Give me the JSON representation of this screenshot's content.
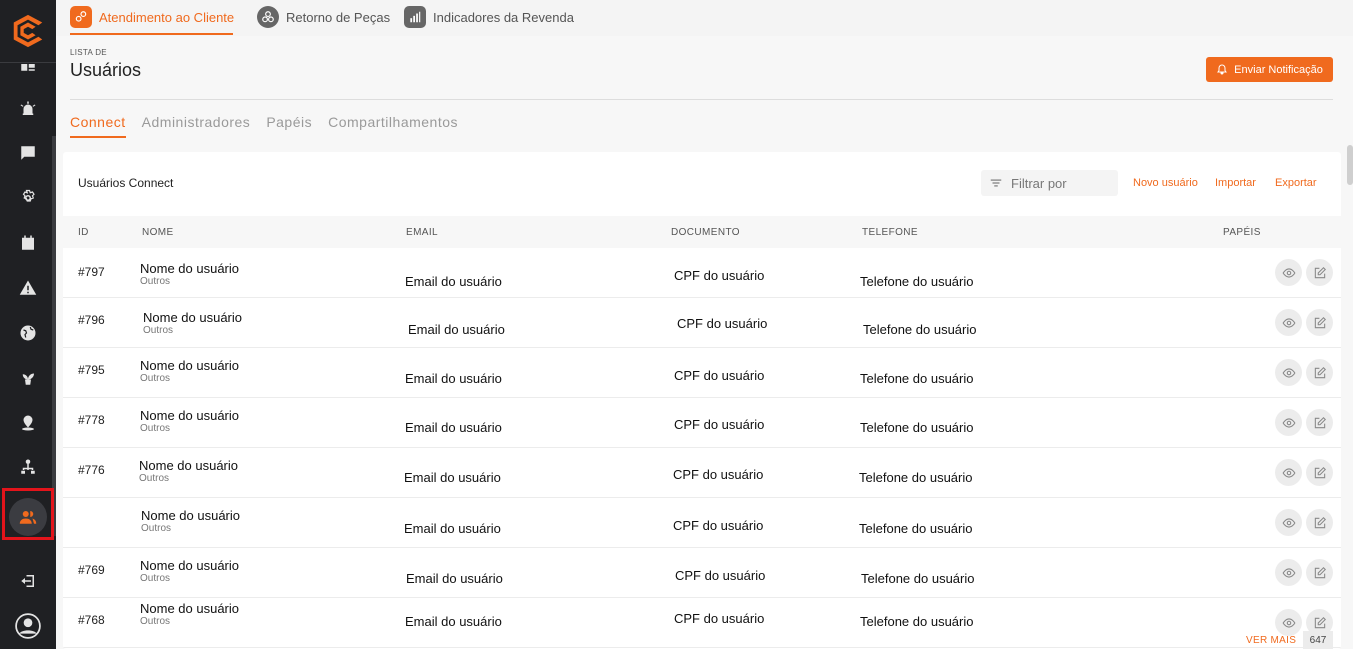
{
  "top_tabs": [
    {
      "label": "Atendimento ao Cliente",
      "icon": "customer-service-icon"
    },
    {
      "label": "Retorno de Peças",
      "icon": "parts-return-icon"
    },
    {
      "label": "Indicadores da Revenda",
      "icon": "bar-chart-icon"
    }
  ],
  "header": {
    "overline": "LISTA DE",
    "title": "Usuários",
    "notify_label": "Enviar Notificação"
  },
  "sub_tabs": [
    "Connect",
    "Administradores",
    "Papéis",
    "Compartilhamentos"
  ],
  "card": {
    "title": "Usuários Connect",
    "filter_placeholder": "Filtrar por",
    "actions": [
      "Novo usuário",
      "Importar",
      "Exportar"
    ]
  },
  "table": {
    "columns": [
      "ID",
      "NOME",
      "EMAIL",
      "DOCUMENTO",
      "TELEFONE",
      "PAPÉIS"
    ],
    "rows": [
      {
        "id": "#797",
        "name": "Nome do usuário",
        "sub": "Outros",
        "email": "Email do usuário",
        "doc": "CPF do usuário",
        "phone": "Telefone do usuário"
      },
      {
        "id": "#796",
        "name": "Nome do usuário",
        "sub": "Outros",
        "email": "Email do usuário",
        "doc": "CPF do usuário",
        "phone": "Telefone do usuário"
      },
      {
        "id": "#795",
        "name": "Nome do usuário",
        "sub": "Outros",
        "email": "Email do usuário",
        "doc": "CPF do usuário",
        "phone": "Telefone do usuário"
      },
      {
        "id": "#778",
        "name": "Nome do usuário",
        "sub": "Outros",
        "email": "Email do usuário",
        "doc": "CPF do usuário",
        "phone": "Telefone do usuário"
      },
      {
        "id": "#776",
        "name": "Nome do usuário",
        "sub": "Outros",
        "email": "Email do usuário",
        "doc": "CPF do usuário",
        "phone": "Telefone do usuário"
      },
      {
        "id": "",
        "name": "Nome do usuário",
        "sub": "Outros",
        "email": "Email do usuário",
        "doc": "CPF do usuário",
        "phone": "Telefone do usuário"
      },
      {
        "id": "#769",
        "name": "Nome do usuário",
        "sub": "Outros",
        "email": "Email do usuário",
        "doc": "CPF do usuário",
        "phone": "Telefone do usuário"
      },
      {
        "id": "#768",
        "name": "Nome do usuário",
        "sub": "Outros",
        "email": "Email do usuário",
        "doc": "CPF do usuário",
        "phone": "Telefone do usuário"
      }
    ]
  },
  "footer": {
    "see_more": "VER MAIS",
    "total": "647"
  },
  "sidebar_icons": [
    "dashboard-icon",
    "alarm-icon",
    "chat-icon",
    "settings-icon",
    "calendar-icon",
    "warning-icon",
    "globe-icon",
    "plant-icon",
    "location-icon",
    "hierarchy-icon",
    "users-icon",
    "logout-icon",
    "user-profile-icon"
  ],
  "colors": {
    "accent": "#f06a1e",
    "sidebar": "#1f2023",
    "highlight": "#e3141b"
  }
}
